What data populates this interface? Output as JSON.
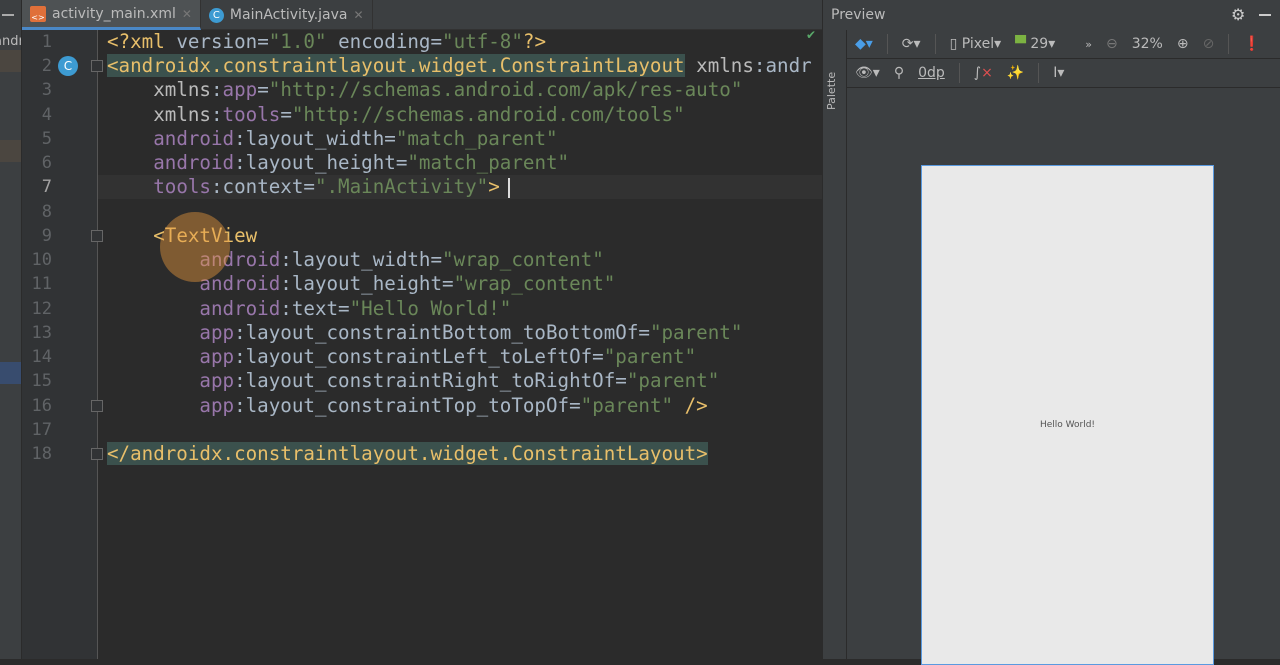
{
  "sidebar": {
    "project_label": "andr"
  },
  "tabs": [
    {
      "label": "activity_main.xml",
      "active": true
    },
    {
      "label": "MainActivity.java",
      "active": false
    }
  ],
  "editor": {
    "current_line": 7,
    "lines": [
      [
        [
          "t-tag",
          "<?"
        ],
        [
          "t-tag",
          "xml "
        ],
        [
          "t-txt",
          "version="
        ],
        [
          "t-str",
          "\"1.0\""
        ],
        [
          "t-txt",
          " encoding="
        ],
        [
          "t-str",
          "\"utf-8\""
        ],
        [
          "t-tag",
          "?>"
        ]
      ],
      [
        [
          "t-tag hl",
          "<androidx.constraintlayout.widget.ConstraintLayout"
        ],
        [
          "t-txt",
          " "
        ],
        [
          "t-attr",
          "xmlns"
        ],
        [
          "t-txt",
          ":andr"
        ]
      ],
      [
        [
          "t-txt",
          "    "
        ],
        [
          "t-attr",
          "xmlns"
        ],
        [
          "t-txt",
          ":"
        ],
        [
          "t-ns",
          "app"
        ],
        [
          "t-txt",
          "="
        ],
        [
          "t-str",
          "\"http://schemas.android.com/apk/res-auto\""
        ]
      ],
      [
        [
          "t-txt",
          "    "
        ],
        [
          "t-attr",
          "xmlns"
        ],
        [
          "t-txt",
          ":"
        ],
        [
          "t-ns",
          "tools"
        ],
        [
          "t-txt",
          "="
        ],
        [
          "t-str",
          "\"http://schemas.android.com/tools\""
        ]
      ],
      [
        [
          "t-txt",
          "    "
        ],
        [
          "t-ns",
          "android"
        ],
        [
          "t-txt",
          ":layout_width="
        ],
        [
          "t-str",
          "\"match_parent\""
        ]
      ],
      [
        [
          "t-txt",
          "    "
        ],
        [
          "t-ns",
          "android"
        ],
        [
          "t-txt",
          ":layout_height="
        ],
        [
          "t-str",
          "\"match_parent\""
        ]
      ],
      [
        [
          "t-txt",
          "    "
        ],
        [
          "t-ns",
          "tools"
        ],
        [
          "t-txt",
          ":context="
        ],
        [
          "t-str",
          "\".MainActivity\""
        ],
        [
          "t-tag",
          ">"
        ]
      ],
      [],
      [
        [
          "t-txt",
          "    "
        ],
        [
          "t-tag",
          "<TextView"
        ]
      ],
      [
        [
          "t-txt",
          "        "
        ],
        [
          "t-ns",
          "android"
        ],
        [
          "t-txt",
          ":layout_width="
        ],
        [
          "t-str",
          "\"wrap_content\""
        ]
      ],
      [
        [
          "t-txt",
          "        "
        ],
        [
          "t-ns",
          "android"
        ],
        [
          "t-txt",
          ":layout_height="
        ],
        [
          "t-str",
          "\"wrap_content\""
        ]
      ],
      [
        [
          "t-txt",
          "        "
        ],
        [
          "t-ns",
          "android"
        ],
        [
          "t-txt",
          ":text="
        ],
        [
          "t-str",
          "\"Hello World!\""
        ]
      ],
      [
        [
          "t-txt",
          "        "
        ],
        [
          "t-ns",
          "app"
        ],
        [
          "t-txt",
          ":layout_constraintBottom_toBottomOf="
        ],
        [
          "t-str",
          "\"parent\""
        ]
      ],
      [
        [
          "t-txt",
          "        "
        ],
        [
          "t-ns",
          "app"
        ],
        [
          "t-txt",
          ":layout_constraintLeft_toLeftOf="
        ],
        [
          "t-str",
          "\"parent\""
        ]
      ],
      [
        [
          "t-txt",
          "        "
        ],
        [
          "t-ns",
          "app"
        ],
        [
          "t-txt",
          ":layout_constraintRight_toRightOf="
        ],
        [
          "t-str",
          "\"parent\""
        ]
      ],
      [
        [
          "t-txt",
          "        "
        ],
        [
          "t-ns",
          "app"
        ],
        [
          "t-txt",
          ":layout_constraintTop_toTopOf="
        ],
        [
          "t-str",
          "\"parent\""
        ],
        [
          "t-tag",
          " />"
        ]
      ],
      [],
      [
        [
          "t-tag hl",
          "</androidx.constraintlayout.widget.ConstraintLayout>"
        ]
      ]
    ]
  },
  "preview": {
    "title": "Preview",
    "device": "Pixel",
    "api_level": "29",
    "zoom": "32%",
    "margin": "0dp",
    "rendered_text": "Hello World!",
    "palette_label": "Palette"
  }
}
